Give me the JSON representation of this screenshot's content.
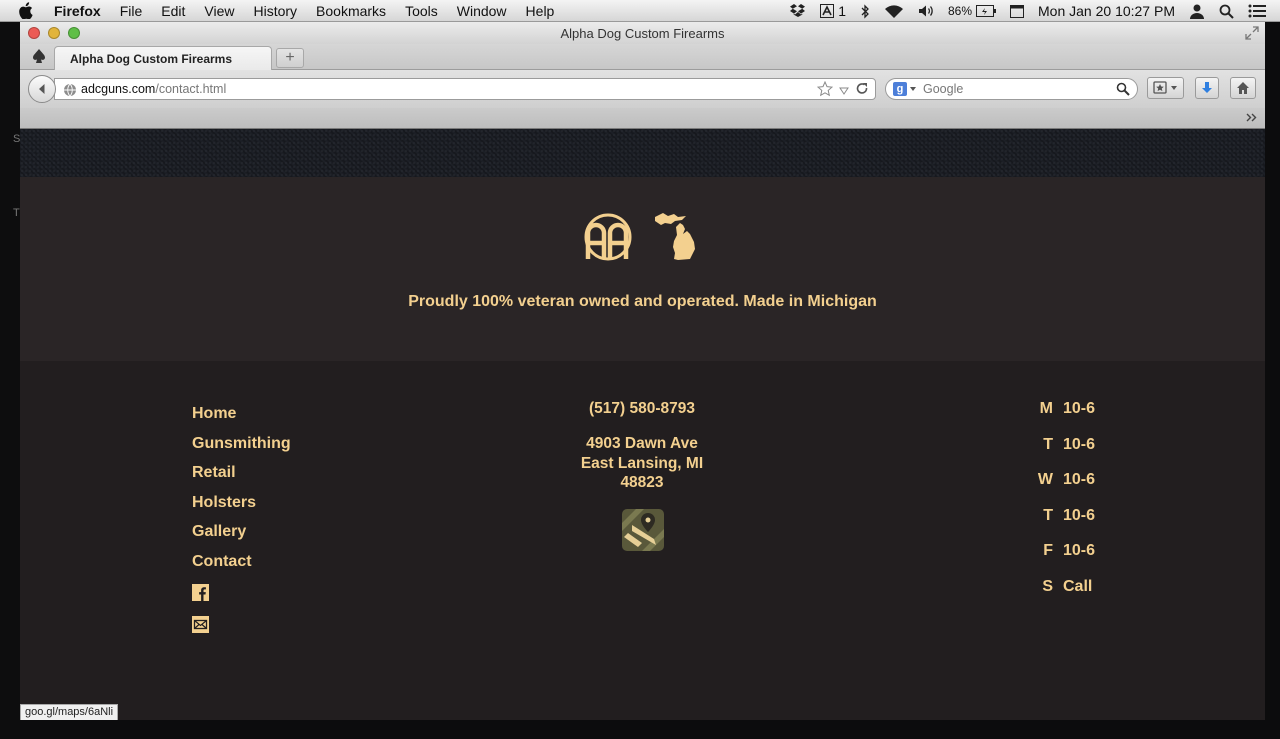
{
  "menubar": {
    "app_name": "Firefox",
    "items": [
      "File",
      "Edit",
      "View",
      "History",
      "Bookmarks",
      "Tools",
      "Window",
      "Help"
    ],
    "adobe_count": "1",
    "battery": "86%",
    "clock": "Mon Jan 20  10:27 PM"
  },
  "window": {
    "title": "Alpha Dog Custom Firearms",
    "tab_title": "Alpha Dog Custom Firearms",
    "new_tab": "+"
  },
  "navbar": {
    "url_host": "adcguns.com",
    "url_path": "/contact.html",
    "search_placeholder": "Google"
  },
  "page": {
    "tagline": "Proudly 100% veteran owned and operated. Made in Michigan",
    "nav_links": [
      "Home",
      "Gunsmithing",
      "Retail",
      "Holsters",
      "Gallery",
      "Contact"
    ],
    "phone": "(517) 580-8793",
    "address_line1": "4903 Dawn Ave",
    "address_line2": "East Lansing, MI",
    "address_line3": "48823",
    "hours": [
      {
        "day": "M",
        "time": "10-6"
      },
      {
        "day": "T",
        "time": "10-6"
      },
      {
        "day": "W",
        "time": "10-6"
      },
      {
        "day": "T",
        "time": "10-6"
      },
      {
        "day": "F",
        "time": "10-6"
      },
      {
        "day": "S",
        "time": "Call"
      }
    ],
    "accent_color": "#f3d08f"
  },
  "status_bar": {
    "link_preview": "goo.gl/maps/6aNli"
  },
  "side_letters": [
    "S",
    "T"
  ]
}
